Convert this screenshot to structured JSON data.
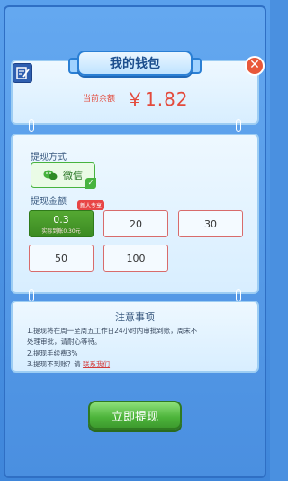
{
  "header": {
    "title": "我的钱包"
  },
  "balance": {
    "label": "当前余额",
    "value": "￥1.82"
  },
  "method": {
    "label": "提现方式",
    "wechat_label": "微信",
    "check_mark": "✓"
  },
  "amount": {
    "label": "提现金额",
    "new_badge": "新人专享",
    "selected": {
      "value": "0.3",
      "sub": "实际到账0.30元"
    },
    "options": [
      "20",
      "30",
      "50",
      "100"
    ]
  },
  "notice": {
    "title": "注意事项",
    "line1": "1.提现将在周一至周五工作日24小时内审批到账，周末不",
    "line2": "处理审批，请耐心等待。",
    "line3": "2.提现手续费3%",
    "line4_prefix": "3.提现不到账？请",
    "line4_link": "联系我们"
  },
  "withdraw_button": "立即提现",
  "close_label": "✕",
  "colors": {
    "accent": "#e34a3c",
    "primary_green": "#4cb33a",
    "frame_blue": "#4a90e0"
  },
  "icons": {
    "edit": "edit-icon",
    "close": "close-icon",
    "wechat": "wechat-icon"
  }
}
